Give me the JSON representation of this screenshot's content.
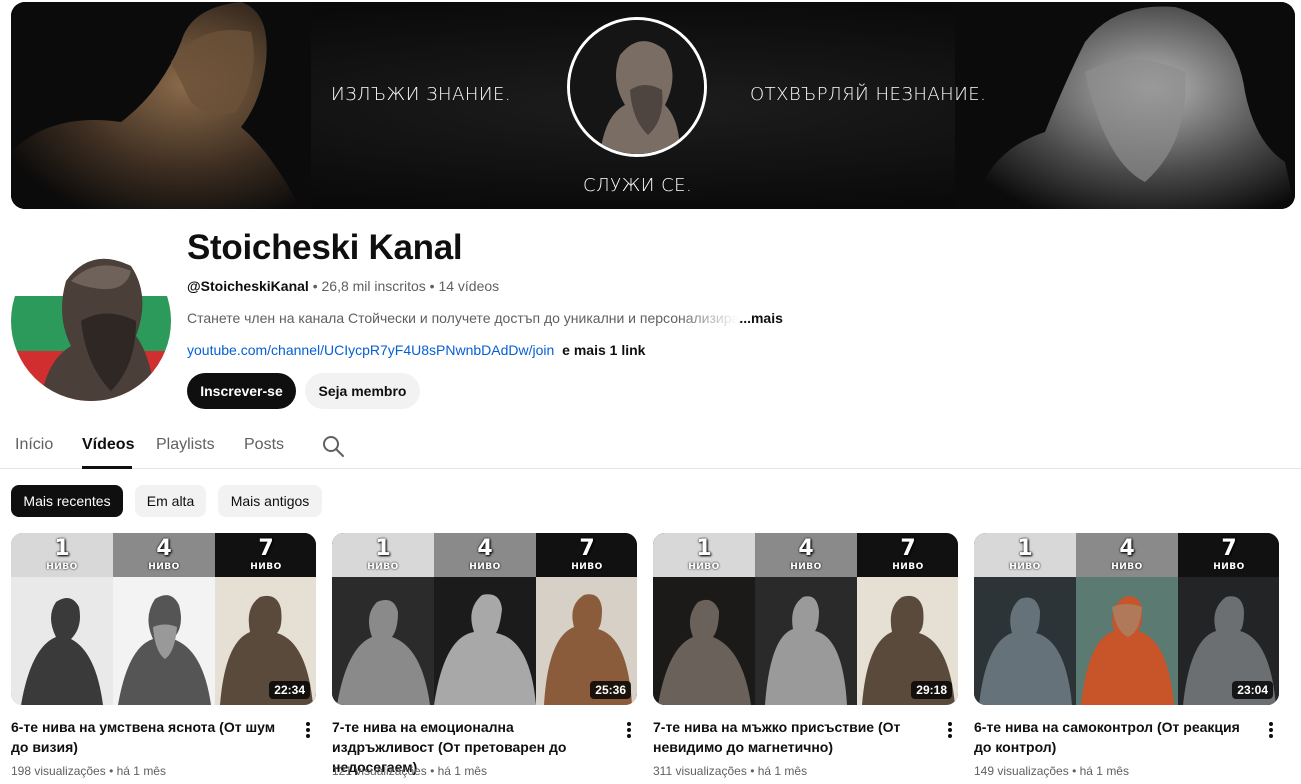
{
  "banner": {
    "text_left": "ИЗЛЪЖИ ЗНАНИЕ.",
    "text_right": "ОТХВЪРЛЯЙ НЕЗНАНИЕ.",
    "text_bottom": "СЛУЖИ СЕ."
  },
  "channel": {
    "name": "Stoicheski Kanal",
    "handle": "@StoicheskiKanal",
    "subscribers": "26,8 mil inscritos",
    "videos_count": "14 vídeos",
    "description": "Станете член на канала Стойчески и получете достъп до уникални и персонализира",
    "more": "...mais",
    "link": "youtube.com/channel/UCIycpR7yF4U8sPNwnbDAdDw/join",
    "link_extra": "e mais 1 link",
    "subscribe_label": "Inscrever-se",
    "join_label": "Seja membro"
  },
  "tabs": [
    {
      "label": "Início"
    },
    {
      "label": "Vídeos"
    },
    {
      "label": "Playlists"
    },
    {
      "label": "Posts"
    }
  ],
  "chips": [
    {
      "label": "Mais recentes"
    },
    {
      "label": "Em alta"
    },
    {
      "label": "Mais antigos"
    }
  ],
  "videos": [
    {
      "title": "6-те нива на умствена яснота (От шум до визия)",
      "duration": "22:34",
      "views": "198 visualizações",
      "age": "há 1 mês",
      "levels": [
        "1",
        "4",
        "7"
      ],
      "level_word": "НИВО"
    },
    {
      "title": "7-те нива на емоционална издръжливост (От претоварен до недосегаем)",
      "duration": "25:36",
      "views": "121 visualizações",
      "age": "há 1 mês",
      "levels": [
        "1",
        "4",
        "7"
      ],
      "level_word": "НИВО"
    },
    {
      "title": "7-те нива на мъжко присъствие (От невидимо до магнетично)",
      "duration": "29:18",
      "views": "311 visualizações",
      "age": "há 1 mês",
      "levels": [
        "1",
        "4",
        "7"
      ],
      "level_word": "НИВО"
    },
    {
      "title": "6-те нива на самоконтрол (От реакция до контрол)",
      "duration": "23:04",
      "views": "149 visualizações",
      "age": "há 1 mês",
      "levels": [
        "1",
        "4",
        "7"
      ],
      "level_word": "НИВО"
    }
  ],
  "separator": "•",
  "colors": {
    "text_primary": "#0f0f0f",
    "text_secondary": "#606060",
    "link": "#065fd4",
    "chip_bg": "#f2f2f2"
  }
}
